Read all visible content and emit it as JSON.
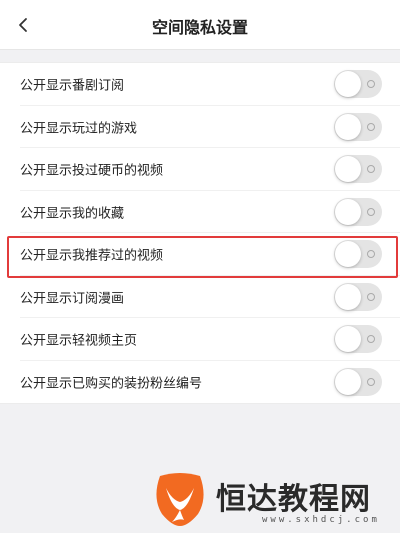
{
  "header": {
    "back_icon": "chevron-left-icon",
    "title": "空间隐私设置"
  },
  "settings": [
    {
      "label": "公开显示番剧订阅",
      "enabled": false
    },
    {
      "label": "公开显示玩过的游戏",
      "enabled": false
    },
    {
      "label": "公开显示投过硬币的视频",
      "enabled": false
    },
    {
      "label": "公开显示我的收藏",
      "enabled": false
    },
    {
      "label": "公开显示我推荐过的视频",
      "enabled": false
    },
    {
      "label": "公开显示订阅漫画",
      "enabled": false
    },
    {
      "label": "公开显示轻视频主页",
      "enabled": false
    },
    {
      "label": "公开显示已购买的装扮粉丝编号",
      "enabled": false
    }
  ],
  "highlight": {
    "color": "#e23b3b",
    "row_index": 4
  },
  "watermark": {
    "text": "恒达教程网",
    "url": "www.sxhdcj.com",
    "logo_color": "#f26a21"
  },
  "colors": {
    "background": "#f1f1f3",
    "toggle_off": "#e4e4e4"
  }
}
